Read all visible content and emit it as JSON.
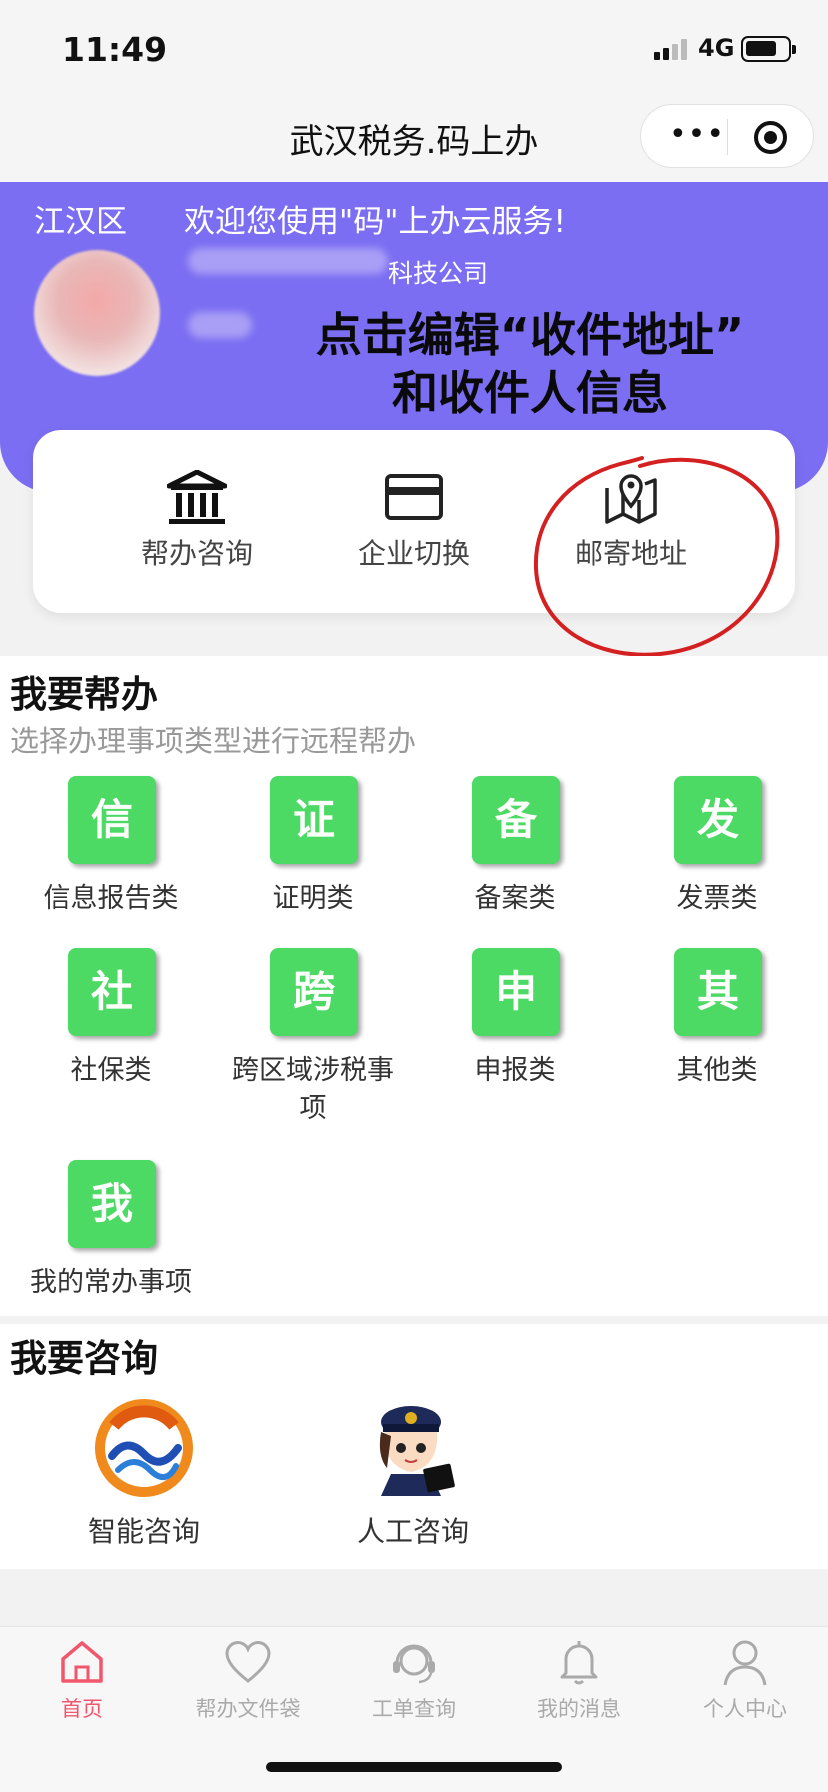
{
  "status": {
    "time": "11:49",
    "network": "4G"
  },
  "nav": {
    "title": "武汉税务.码上办"
  },
  "banner": {
    "district": "江汉区",
    "welcome": "欢迎您使用\"码\"上办云服务!",
    "company_suffix": "科技公司",
    "overlay_line1": "点击编辑“收件地址”",
    "overlay_line2": "和收件人信息"
  },
  "quick": [
    {
      "label": "帮办咨询",
      "icon": "bank-icon"
    },
    {
      "label": "企业切换",
      "icon": "card-icon"
    },
    {
      "label": "邮寄地址",
      "icon": "map-pin-icon"
    }
  ],
  "help_section": {
    "title": "我要帮办",
    "subtitle": "选择办理事项类型进行远程帮办",
    "items": [
      {
        "glyph": "信",
        "label": "信息报告类"
      },
      {
        "glyph": "证",
        "label": "证明类"
      },
      {
        "glyph": "备",
        "label": "备案类"
      },
      {
        "glyph": "发",
        "label": "发票类"
      },
      {
        "glyph": "社",
        "label": "社保类"
      },
      {
        "glyph": "跨",
        "label": "跨区域涉税事项"
      },
      {
        "glyph": "申",
        "label": "申报类"
      },
      {
        "glyph": "其",
        "label": "其他类"
      },
      {
        "glyph": "我",
        "label": "我的常办事项"
      }
    ]
  },
  "consult_section": {
    "title": "我要咨询",
    "items": [
      {
        "label": "智能咨询",
        "icon": "12366-logo-icon"
      },
      {
        "label": "人工咨询",
        "icon": "tax-officer-avatar-icon"
      }
    ]
  },
  "tabs": [
    {
      "label": "首页",
      "icon": "home-icon",
      "active": true
    },
    {
      "label": "帮办文件袋",
      "icon": "heart-icon",
      "active": false
    },
    {
      "label": "工单查询",
      "icon": "headset-icon",
      "active": false
    },
    {
      "label": "我的消息",
      "icon": "bell-icon",
      "active": false
    },
    {
      "label": "个人中心",
      "icon": "person-icon",
      "active": false
    }
  ],
  "colors": {
    "banner": "#7b6ef2",
    "tile": "#4cd964",
    "active_tab": "#f0566c",
    "annotation": "#d42020"
  }
}
